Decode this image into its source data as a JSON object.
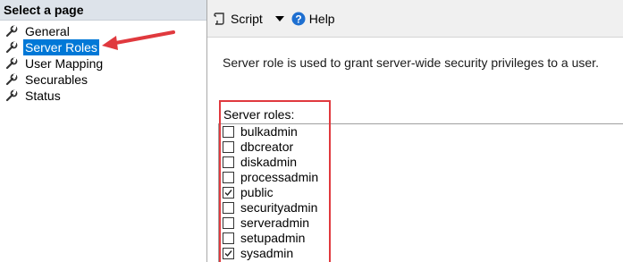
{
  "sidebar": {
    "header": "Select a page",
    "items": [
      {
        "label": "General",
        "selected": false
      },
      {
        "label": "Server Roles",
        "selected": true
      },
      {
        "label": "User Mapping",
        "selected": false
      },
      {
        "label": "Securables",
        "selected": false
      },
      {
        "label": "Status",
        "selected": false
      }
    ]
  },
  "toolbar": {
    "script_label": "Script",
    "help_label": "Help"
  },
  "main": {
    "description": "Server role is used to grant server-wide security privileges to a user.",
    "roles_label": "Server roles:",
    "roles": [
      {
        "name": "bulkadmin",
        "checked": false
      },
      {
        "name": "dbcreator",
        "checked": false
      },
      {
        "name": "diskadmin",
        "checked": false
      },
      {
        "name": "processadmin",
        "checked": false
      },
      {
        "name": "public",
        "checked": true
      },
      {
        "name": "securityadmin",
        "checked": false
      },
      {
        "name": "serveradmin",
        "checked": false
      },
      {
        "name": "setupadmin",
        "checked": false
      },
      {
        "name": "sysadmin",
        "checked": true
      }
    ]
  },
  "colors": {
    "selection": "#0078d7",
    "annotation": "#e0393e"
  }
}
